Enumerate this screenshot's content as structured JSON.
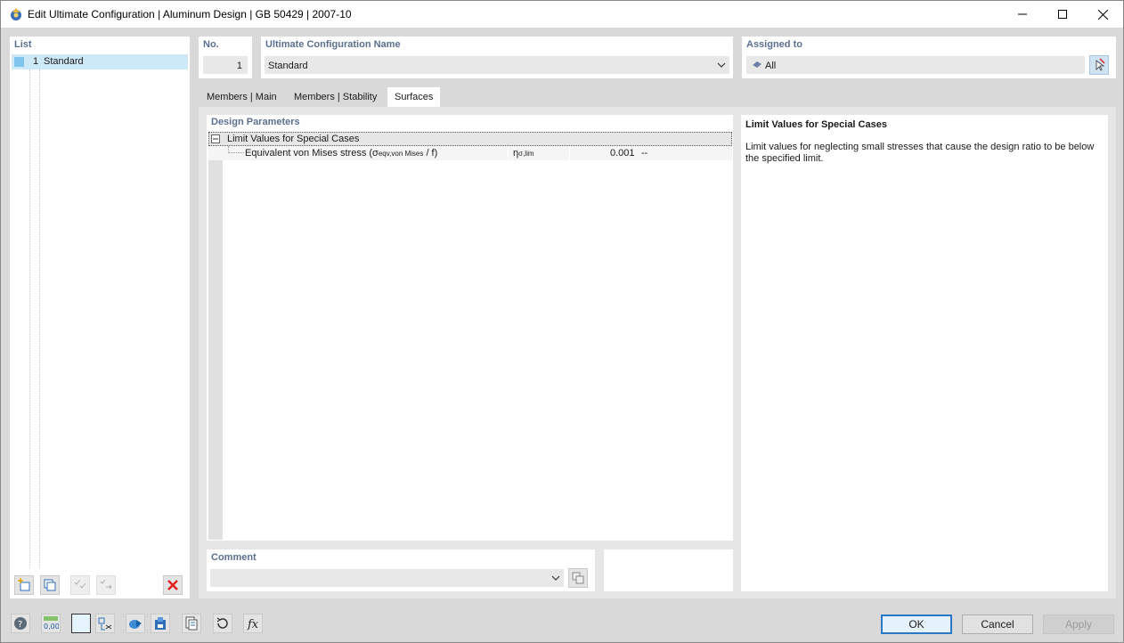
{
  "window": {
    "title": "Edit Ultimate Configuration | Aluminum Design | GB 50429 | 2007-10",
    "minimize_icon": "minimize-icon",
    "maximize_icon": "maximize-icon",
    "close_icon": "close-icon"
  },
  "list": {
    "label": "List",
    "items": [
      {
        "number": "1",
        "name": "Standard",
        "color": "#7fc4ea"
      }
    ]
  },
  "header": {
    "no_label": "No.",
    "no_value": "1",
    "name_label": "Ultimate Configuration Name",
    "name_value": "Standard",
    "assigned_label": "Assigned to",
    "assigned_value": "All"
  },
  "tabs": [
    {
      "label": "Members | Main",
      "active": false
    },
    {
      "label": "Members | Stability",
      "active": false
    },
    {
      "label": "Surfaces",
      "active": true
    }
  ],
  "design_parameters": {
    "label": "Design Parameters",
    "group": {
      "label": "Limit Values for Special Cases",
      "rows": [
        {
          "name": "Equivalent von Mises stress (σ",
          "name_sub": "eqv,von Mises",
          "name_end": " / f)",
          "symbol": "η",
          "symbol_sub": "σ,lim",
          "value": "0.001",
          "unit": "--"
        }
      ]
    }
  },
  "info": {
    "title": "Limit Values for Special Cases",
    "text": "Limit values for neglecting small stresses that cause the design ratio to be below the specified limit."
  },
  "comment": {
    "label": "Comment",
    "value": ""
  },
  "buttons": {
    "ok": "OK",
    "cancel": "Cancel",
    "apply": "Apply"
  },
  "colors": {
    "accent": "#2b78c6",
    "section_label": "#5b6f8f",
    "selection": "#cde8f7",
    "delete": "#e02020"
  }
}
